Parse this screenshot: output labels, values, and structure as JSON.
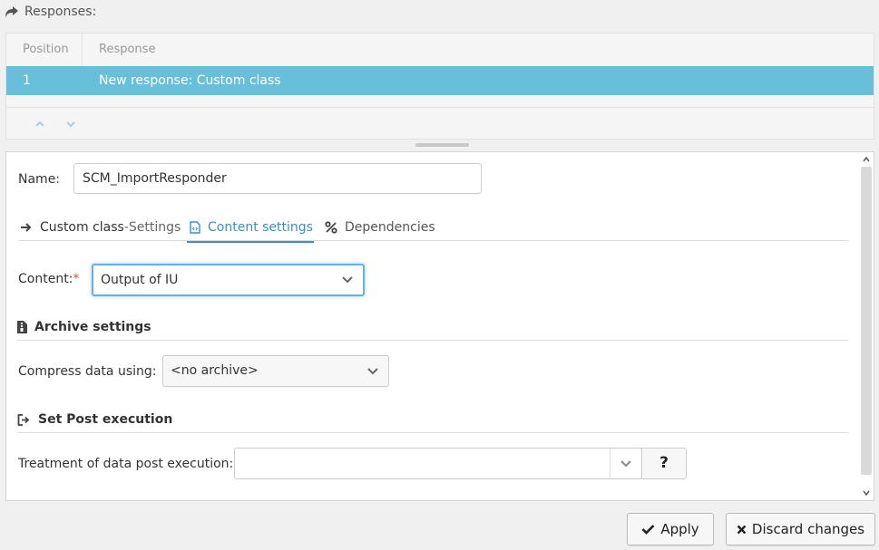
{
  "header": {
    "title": "Responses:",
    "icon": "share-arrow-icon"
  },
  "grid": {
    "columns": [
      "Position",
      "Response"
    ],
    "rows": [
      {
        "position": "1",
        "response": "New response: Custom class"
      }
    ]
  },
  "form": {
    "name_label": "Name:",
    "name_value": "SCM_ImportResponder",
    "tabs": [
      {
        "label_main": "Custom class",
        "label_suffix": "-Settings",
        "icon": "arrow-right-icon"
      },
      {
        "label": "Content settings",
        "icon": "file-code-icon",
        "active": true
      },
      {
        "label": "Dependencies",
        "icon": "percent-icon"
      }
    ],
    "content_label": "Content:",
    "content_required": "*",
    "content_value": "Output of IU",
    "archive_section": "Archive settings",
    "compress_label": "Compress data using:",
    "compress_value": "<no archive>",
    "post_section": "Set Post execution",
    "post_label": "Treatment of data post execution:",
    "post_value": "",
    "help_label": "?"
  },
  "buttons": {
    "apply": "Apply",
    "discard": "Discard changes"
  },
  "colors": {
    "selected_row": "#67bfd9",
    "accent": "#3a8fc0",
    "required": "#d9534f"
  }
}
